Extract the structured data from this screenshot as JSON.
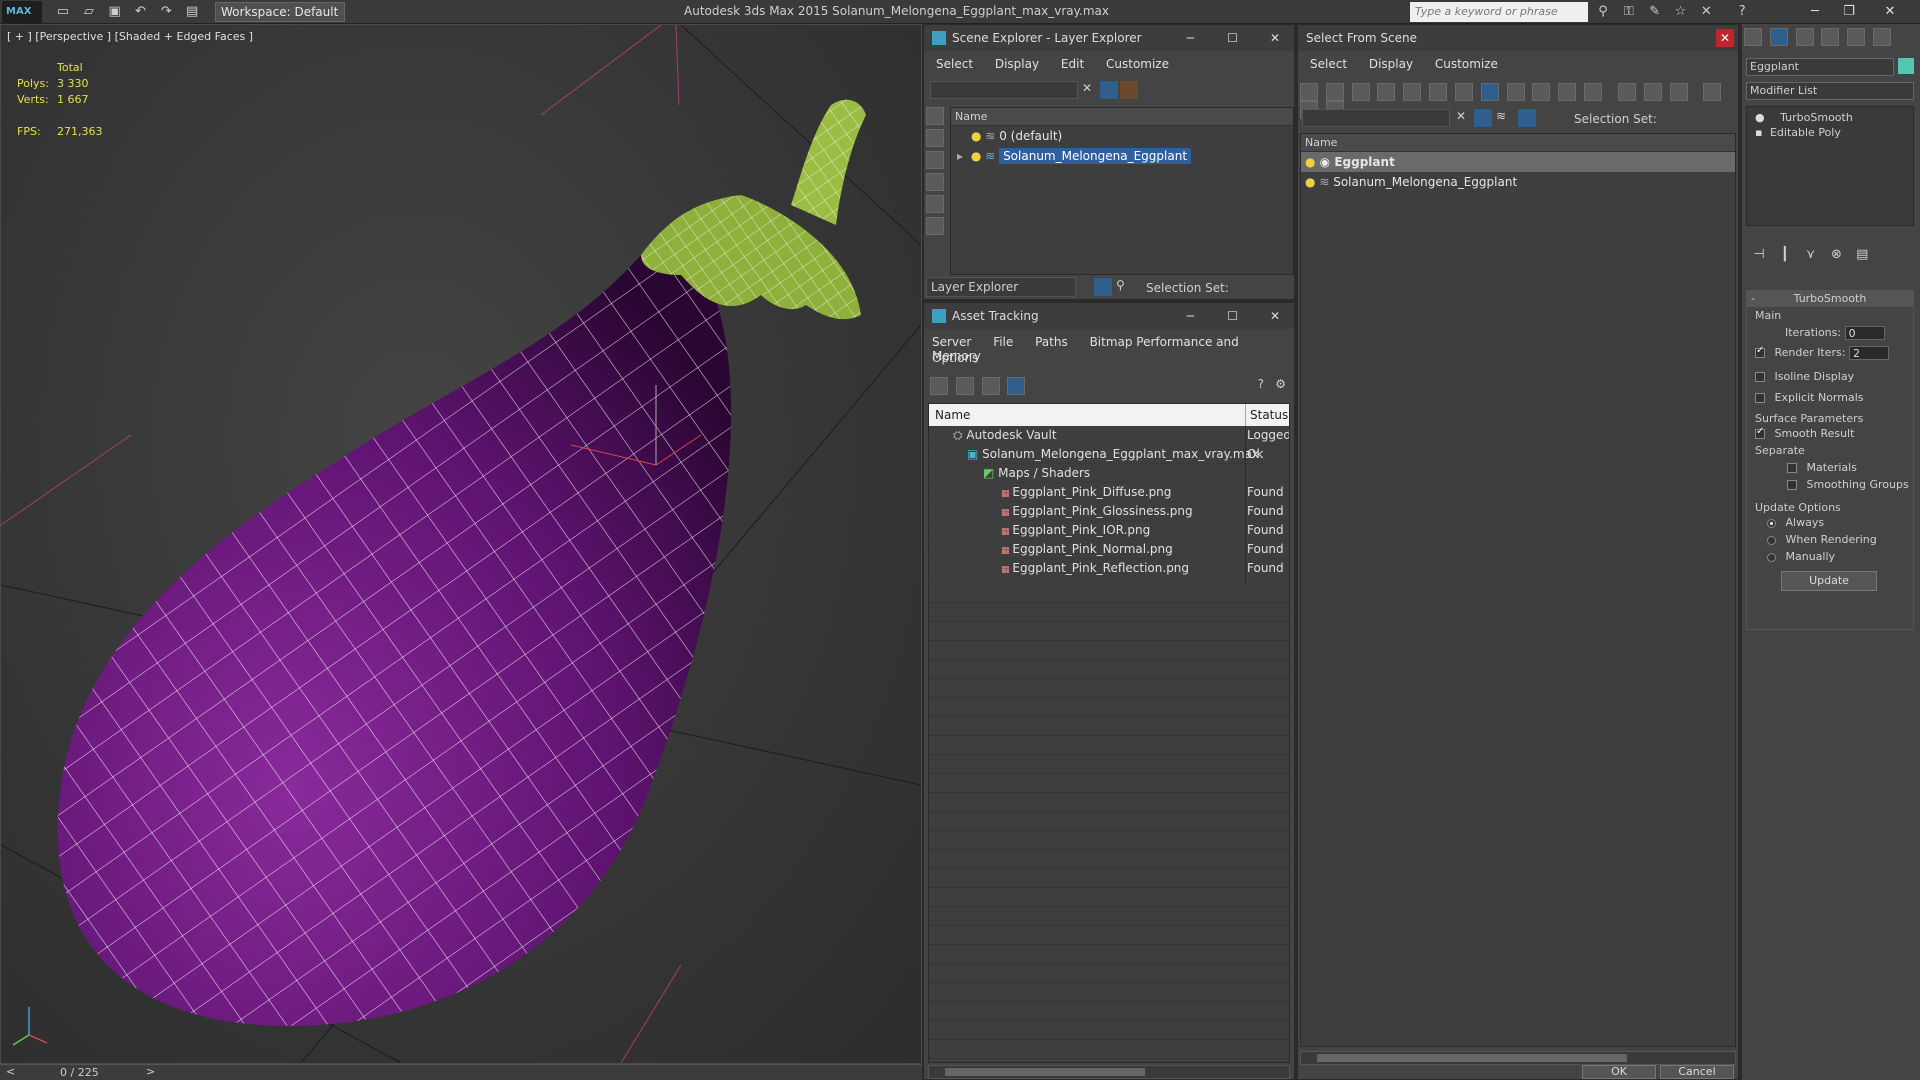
{
  "app": {
    "title": "Autodesk 3ds Max  2015     Solanum_Melongena_Eggplant_max_vray.max",
    "logo": "MAX",
    "workspace_label": "Workspace: Default",
    "search_placeholder": "Type a keyword or phrase"
  },
  "viewport": {
    "label": "[ + ] [Perspective ] [Shaded + Edged Faces ]",
    "stats": {
      "total_label": "Total",
      "polys_label": "Polys:",
      "polys_value": "3 330",
      "verts_label": "Verts:",
      "verts_value": "1 667",
      "fps_label": "FPS:",
      "fps_value": "271,363"
    },
    "timeline_value": "0 / 225"
  },
  "scene_explorer": {
    "title": "Scene Explorer - Layer Explorer",
    "menu": [
      "Select",
      "Display",
      "Edit",
      "Customize"
    ],
    "column_name": "Name",
    "rows": [
      {
        "label": "0 (default)",
        "selected": false
      },
      {
        "label": "Solanum_Melongena_Eggplant",
        "selected": true
      }
    ],
    "footer_dropdown": "Layer Explorer",
    "footer_selection_set": "Selection Set:"
  },
  "asset_tracking": {
    "title": "Asset Tracking",
    "menu": [
      "Server",
      "File",
      "Paths",
      "Bitmap Performance and Memory"
    ],
    "menu2": [
      "Options"
    ],
    "col_name": "Name",
    "col_status": "Status",
    "rows": [
      {
        "name": "Autodesk Vault",
        "status": "Logged",
        "indent": 1
      },
      {
        "name": "Solanum_Melongena_Eggplant_max_vray.max",
        "status": "Ok",
        "indent": 2
      },
      {
        "name": "Maps / Shaders",
        "status": "",
        "indent": 3
      },
      {
        "name": "Eggplant_Pink_Diffuse.png",
        "status": "Found",
        "indent": 4
      },
      {
        "name": "Eggplant_Pink_Glossiness.png",
        "status": "Found",
        "indent": 4
      },
      {
        "name": "Eggplant_Pink_IOR.png",
        "status": "Found",
        "indent": 4
      },
      {
        "name": "Eggplant_Pink_Normal.png",
        "status": "Found",
        "indent": 4
      },
      {
        "name": "Eggplant_Pink_Reflection.png",
        "status": "Found",
        "indent": 4
      }
    ]
  },
  "select_from_scene": {
    "title": "Select From Scene",
    "menu": [
      "Select",
      "Display",
      "Customize"
    ],
    "selection_set_label": "Selection Set:",
    "column_name": "Name",
    "rows": [
      {
        "label": "Eggplant",
        "selected": true
      },
      {
        "label": "Solanum_Melongena_Eggplant",
        "selected": false
      }
    ],
    "ok_label": "OK",
    "cancel_label": "Cancel"
  },
  "command_panel": {
    "object_name": "Eggplant",
    "modifier_list": "Modifier List",
    "stack": [
      "TurboSmooth",
      "Editable Poly"
    ],
    "rollout_title": "TurboSmooth",
    "main_label": "Main",
    "iterations_label": "Iterations:",
    "iterations_value": "0",
    "render_iters_label": "Render Iters:",
    "render_iters_value": "2",
    "isoline_label": "Isoline Display",
    "explicit_normals_label": "Explicit Normals",
    "surface_params_label": "Surface Parameters",
    "smooth_result_label": "Smooth Result",
    "separate_label": "Separate",
    "materials_label": "Materials",
    "smoothing_groups_label": "Smoothing Groups",
    "update_options_label": "Update Options",
    "always_label": "Always",
    "when_rendering_label": "When Rendering",
    "manually_label": "Manually",
    "update_button": "Update"
  },
  "colors": {
    "accent_blue": "#2f5f8f",
    "eggplant_purple": "#6a1e7a",
    "stem_green": "#8fb03a",
    "stat_yellow": "#e4e04a"
  }
}
